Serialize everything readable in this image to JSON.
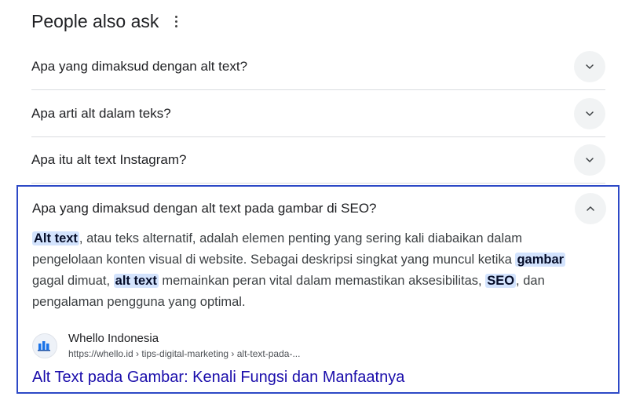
{
  "header": {
    "title": "People also ask"
  },
  "questions": [
    {
      "label": "Apa yang dimaksud dengan alt text?"
    },
    {
      "label": "Apa arti alt dalam teks?"
    },
    {
      "label": "Apa itu alt text Instagram?"
    }
  ],
  "expanded": {
    "question": "Apa yang dimaksud dengan alt text pada gambar di SEO?",
    "answer": {
      "hl1": "Alt text",
      "t1": ", atau teks alternatif, adalah elemen penting yang sering kali diabaikan dalam pengelolaan konten visual di website. Sebagai deskripsi singkat yang muncul ketika ",
      "hl2": "gambar",
      "t2": " gagal dimuat, ",
      "hl3": "alt text",
      "t3": " memainkan peran vital dalam memastikan aksesibilitas, ",
      "hl4": "SEO",
      "t4": ", dan pengalaman pengguna yang optimal."
    },
    "source": {
      "name": "Whello Indonesia",
      "url": "https://whello.id › tips-digital-marketing › alt-text-pada-..."
    },
    "link_title": "Alt Text pada Gambar: Kenali Fungsi dan Manfaatnya"
  },
  "colors": {
    "accent_border": "#2d49c6",
    "link": "#1a0dab",
    "highlight": "#d3e3fd"
  },
  "icons": {
    "menu": "more-vert-icon",
    "collapsed": "chevron-down-icon",
    "expanded": "chevron-up-icon"
  }
}
